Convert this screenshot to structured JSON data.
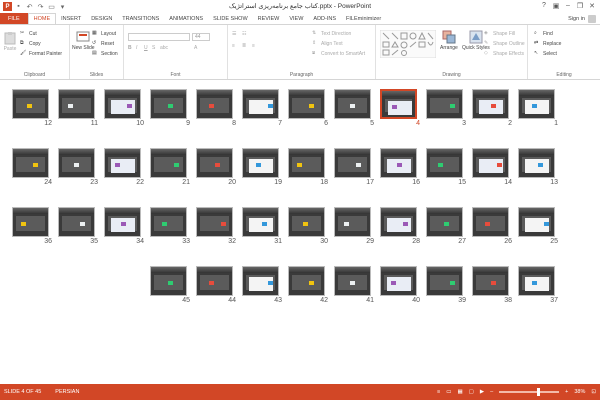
{
  "app": {
    "title": "کتاب جامع برنامه‌ریزی استراتژیک.pptx - PowerPoint",
    "logo": "P"
  },
  "window": {
    "minimize": "–",
    "restore": "❐",
    "close": "✕",
    "help": "?",
    "ribbon_display": "▣"
  },
  "tabs": [
    "FILE",
    "HOME",
    "INSERT",
    "DESIGN",
    "TRANSITIONS",
    "ANIMATIONS",
    "SLIDE SHOW",
    "REVIEW",
    "VIEW",
    "ADD-INS",
    "FILEminimizer"
  ],
  "active_tab": "HOME",
  "account": {
    "label": "Sign in"
  },
  "ribbon": {
    "clipboard": {
      "label": "Clipboard",
      "paste": "Paste",
      "cut": "Cut",
      "copy": "Copy",
      "format_painter": "Format Painter"
    },
    "slides": {
      "label": "Slides",
      "new_slide": "New Slide",
      "layout": "Layout",
      "reset": "Reset",
      "section": "Section"
    },
    "font": {
      "label": "Font",
      "size": "44"
    },
    "paragraph": {
      "label": "Paragraph",
      "text_direction": "Text Direction",
      "align_text": "Align Text",
      "convert": "Convert to SmartArt"
    },
    "drawing": {
      "label": "Drawing",
      "arrange": "Arrange",
      "quick_styles": "Quick Styles",
      "shape_fill": "Shape Fill",
      "shape_outline": "Shape Outline",
      "shape_effects": "Shape Effects"
    },
    "editing": {
      "label": "Editing",
      "find": "Find",
      "replace": "Replace",
      "select": "Select"
    }
  },
  "slides": {
    "selected": 4,
    "rows": [
      [
        12,
        11,
        10,
        9,
        8,
        7,
        6,
        5,
        4,
        3,
        2,
        1
      ],
      [
        24,
        23,
        22,
        21,
        20,
        19,
        18,
        17,
        16,
        15,
        14,
        13
      ],
      [
        36,
        35,
        34,
        33,
        32,
        31,
        30,
        29,
        28,
        27,
        26,
        25
      ],
      [
        45,
        44,
        43,
        42,
        41,
        40,
        39,
        38,
        37
      ]
    ]
  },
  "status": {
    "slide_info": "SLIDE 4 OF 45",
    "language": "PERSIAN",
    "zoom": "38%",
    "zoom_minus": "–",
    "zoom_plus": "+"
  },
  "colors": {
    "accent": "#d24726",
    "thumb_bg": "#3a3a3a"
  }
}
